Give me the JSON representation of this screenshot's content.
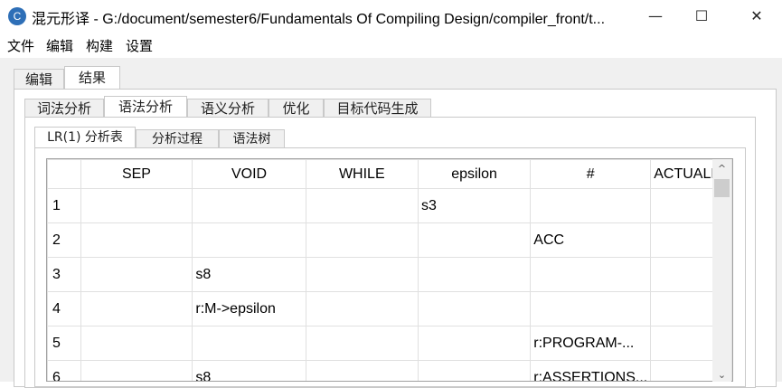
{
  "window": {
    "app_name": "混元形译",
    "title": "混元形译 - G:/document/semester6/Fundamentals Of Compiling Design/compiler_front/t...",
    "minimize": "—",
    "maximize": "☐",
    "close": "✕"
  },
  "menu": {
    "items": [
      "文件",
      "编辑",
      "构建",
      "设置"
    ]
  },
  "top_tabs": [
    "编辑",
    "结果"
  ],
  "analysis_tabs": [
    "词法分析",
    "语法分析",
    "语义分析",
    "优化",
    "目标代码生成"
  ],
  "sub_tabs": [
    "LR(1) 分析表",
    "分析过程",
    "语法树"
  ],
  "table": {
    "columns": [
      "",
      "SEP",
      "VOID",
      "WHILE",
      "epsilon",
      "#",
      "ACTUALF"
    ],
    "rows": [
      [
        "1",
        "",
        "",
        "",
        "s3",
        "",
        ""
      ],
      [
        "2",
        "",
        "",
        "",
        "",
        "ACC",
        ""
      ],
      [
        "3",
        "",
        "s8",
        "",
        "",
        "",
        ""
      ],
      [
        "4",
        "",
        "r:M->epsilon",
        "",
        "",
        "",
        ""
      ],
      [
        "5",
        "",
        "",
        "",
        "",
        "r:PROGRAM-...",
        ""
      ],
      [
        "6",
        "",
        "s8",
        "",
        "",
        "r:ASSERTIONS...",
        ""
      ]
    ]
  },
  "scrollbar": {
    "up": "^",
    "down": "⌄"
  }
}
